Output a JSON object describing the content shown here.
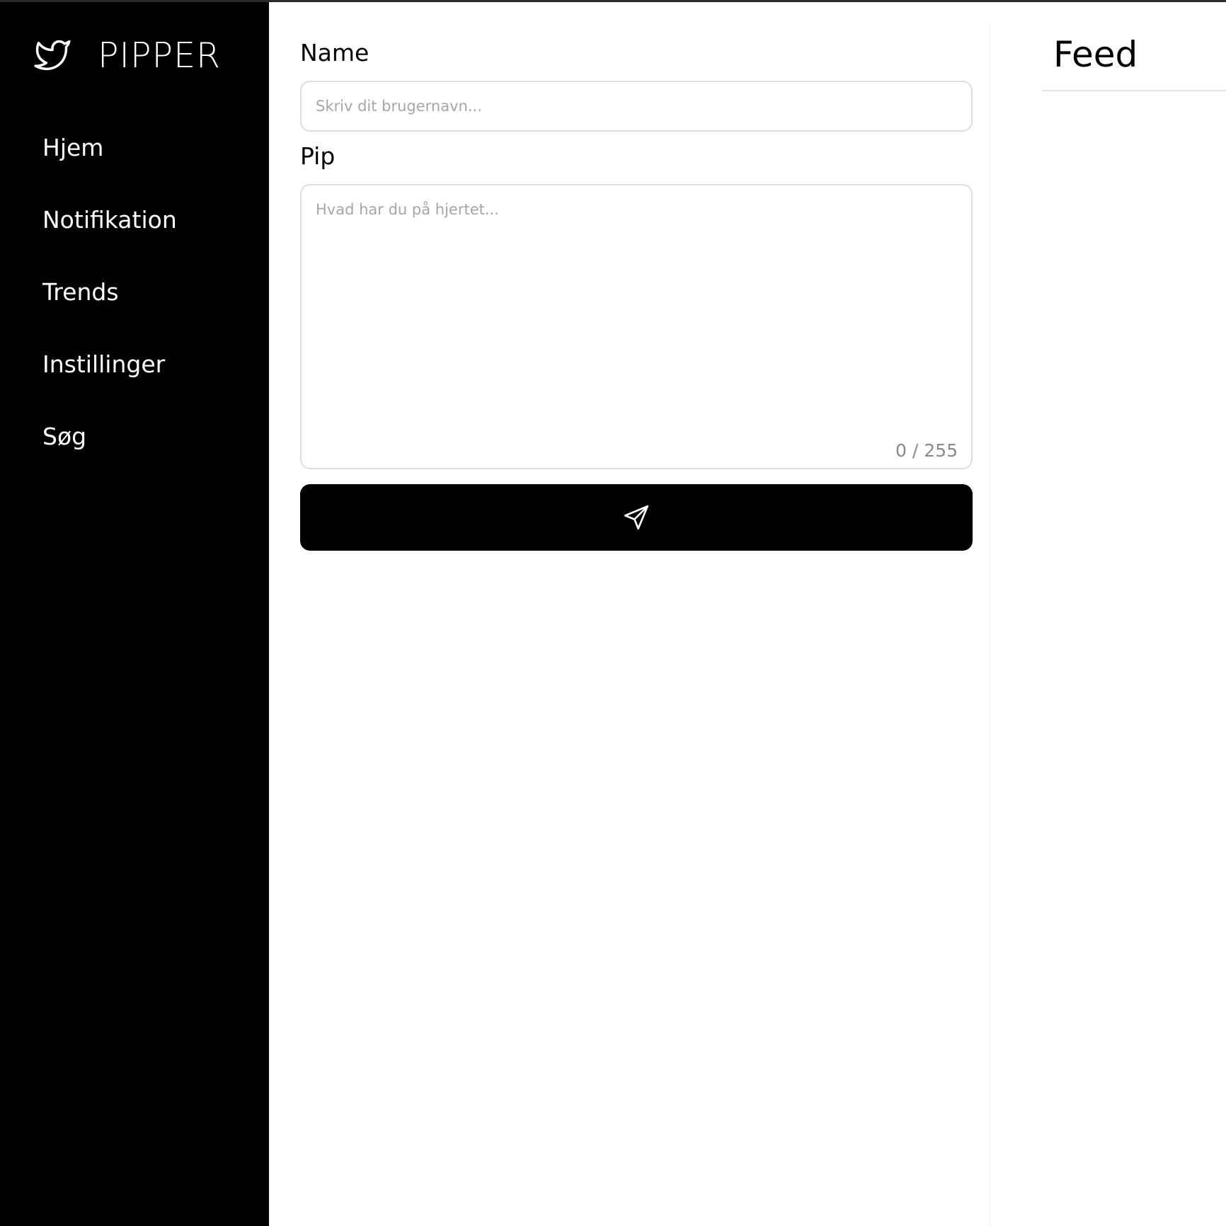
{
  "brand": {
    "name": "PIPPER",
    "icon": "bird-icon"
  },
  "sidebar": {
    "items": [
      {
        "label": "Hjem"
      },
      {
        "label": "Notifikation"
      },
      {
        "label": "Trends"
      },
      {
        "label": "Instillinger"
      },
      {
        "label": "Søg"
      }
    ]
  },
  "composer": {
    "name_label": "Name",
    "name_placeholder": "Skriv dit brugernavn...",
    "name_value": "",
    "pip_label": "Pip",
    "pip_placeholder": "Hvad har du på hjertet...",
    "pip_value": "",
    "char_count": "0 / 255",
    "send_icon": "send-icon"
  },
  "feed": {
    "title": "Feed"
  },
  "colors": {
    "sidebar_bg": "#000000",
    "button_bg": "#000000",
    "input_border": "#dedede",
    "placeholder": "#a6a6a6"
  }
}
